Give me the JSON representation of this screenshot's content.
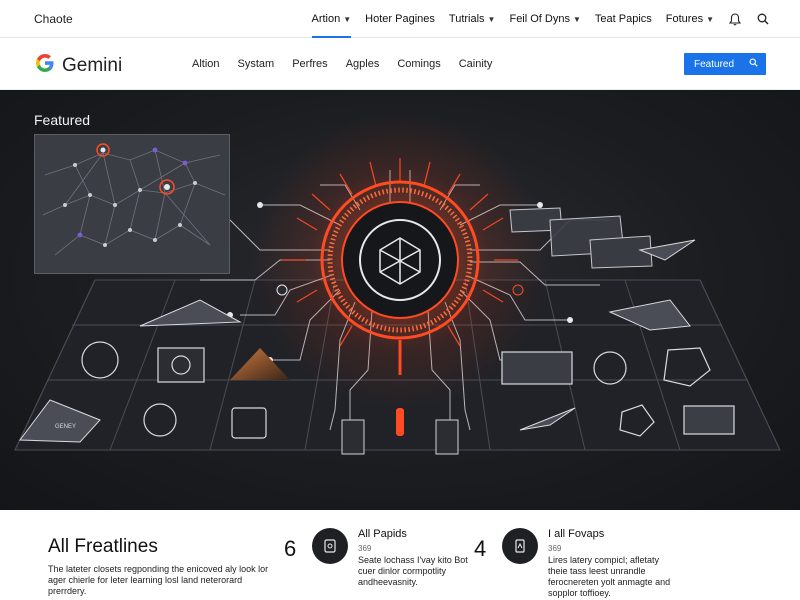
{
  "topbar": {
    "brand": "Chaote",
    "nav": [
      {
        "label": "Artion",
        "caret": true,
        "active": true
      },
      {
        "label": "Hoter Pagines",
        "caret": false
      },
      {
        "label": "Tutrials",
        "caret": true
      },
      {
        "label": "Feil Of Dyns",
        "caret": true
      },
      {
        "label": "Teat Papics",
        "caret": false
      },
      {
        "label": "Fotures",
        "caret": true
      }
    ],
    "icons": [
      "bell-icon",
      "search-icon"
    ]
  },
  "header": {
    "logo_text": "Gemini",
    "nav": [
      "Altion",
      "Systam",
      "Perfres",
      "Agples",
      "Comings",
      "Cainity"
    ],
    "featured_button": "Featured"
  },
  "hero": {
    "title": "Featured"
  },
  "bottom": {
    "heading": "All Freatlines",
    "description": "The lateter closets regponding the enicoved aly look lor ager chierle for leter learning losl land neterorard prerrdery.",
    "stats": [
      {
        "number": "6",
        "title": "All Papids",
        "small": "369",
        "body": "Seate lochass I'vay kito Bot cuer dinlor cormpotlity andheevasnity."
      },
      {
        "number": "4",
        "title": "I all Fovaps",
        "small": "369",
        "body": "Lires latery compicl; afletaty theie tass leest unrandle ferocnereten yolt anmagte and sopplor toffioey."
      }
    ]
  },
  "colors": {
    "accent": "#1a73e8",
    "hero_bg": "#1b1d21",
    "glow": "#ff4a22"
  }
}
